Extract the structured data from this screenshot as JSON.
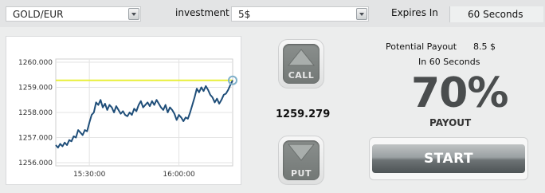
{
  "topbar": {
    "asset": "GOLD/EUR",
    "investment_label": "investment",
    "investment_value": "5$",
    "expires_label": "Expires In",
    "expires_value": "60 Seconds"
  },
  "chart_data": {
    "type": "line",
    "ylim": [
      1256.0,
      1260.0
    ],
    "yticks": [
      "1256.000",
      "1257.000",
      "1258.000",
      "1259.000",
      "1260.000"
    ],
    "xticks": [
      "15:30:00",
      "16:00:00"
    ],
    "threshold": 1259.279,
    "colors": {
      "line": "#1f4e79",
      "threshold": "#e8ef3a",
      "marker": "#7fb0c9",
      "grid": "#e3e3e3"
    },
    "x": [
      0,
      1,
      2,
      3,
      4,
      5,
      6,
      7,
      8,
      9,
      10,
      11,
      12,
      13,
      14,
      15,
      16,
      17,
      18,
      19,
      20,
      21,
      22,
      23,
      24,
      25,
      26,
      27,
      28,
      29,
      30,
      31,
      32,
      33,
      34,
      35,
      36,
      37,
      38,
      39,
      40,
      41,
      42,
      43,
      44,
      45,
      46,
      47,
      48,
      49,
      50,
      51,
      52,
      53,
      54,
      55,
      56,
      57,
      58,
      59,
      60,
      61,
      62,
      63,
      64,
      65,
      66,
      67,
      68,
      69,
      70,
      71,
      72,
      73,
      74,
      75,
      76,
      77,
      78,
      79
    ],
    "values": [
      1256.7,
      1256.6,
      1256.75,
      1256.65,
      1256.8,
      1256.7,
      1256.9,
      1256.85,
      1257.05,
      1257.0,
      1257.3,
      1257.2,
      1257.1,
      1257.3,
      1257.25,
      1257.6,
      1257.9,
      1258.0,
      1258.4,
      1258.3,
      1258.5,
      1258.2,
      1258.35,
      1258.1,
      1258.3,
      1258.2,
      1258.0,
      1258.25,
      1258.1,
      1257.95,
      1258.05,
      1257.9,
      1257.85,
      1258.0,
      1257.9,
      1258.15,
      1258.05,
      1258.3,
      1258.45,
      1258.2,
      1258.3,
      1258.4,
      1258.25,
      1258.45,
      1258.3,
      1258.5,
      1258.35,
      1258.2,
      1258.1,
      1258.3,
      1258.0,
      1258.2,
      1258.1,
      1257.95,
      1257.7,
      1257.9,
      1257.8,
      1257.65,
      1257.8,
      1257.75,
      1258.0,
      1258.3,
      1258.6,
      1258.95,
      1258.8,
      1259.0,
      1258.85,
      1259.05,
      1258.9,
      1258.7,
      1258.6,
      1258.4,
      1258.55,
      1258.35,
      1258.5,
      1258.7,
      1258.75,
      1258.9,
      1259.1,
      1259.279
    ]
  },
  "call_label": "CALL",
  "put_label": "PUT",
  "current_price": "1259.279",
  "payout": {
    "potential_label": "Potential Payout",
    "potential_value": "8.5 $",
    "in_seconds": "In 60 Seconds",
    "percent": "70%",
    "word": "PAYOUT"
  },
  "start_label": "START"
}
